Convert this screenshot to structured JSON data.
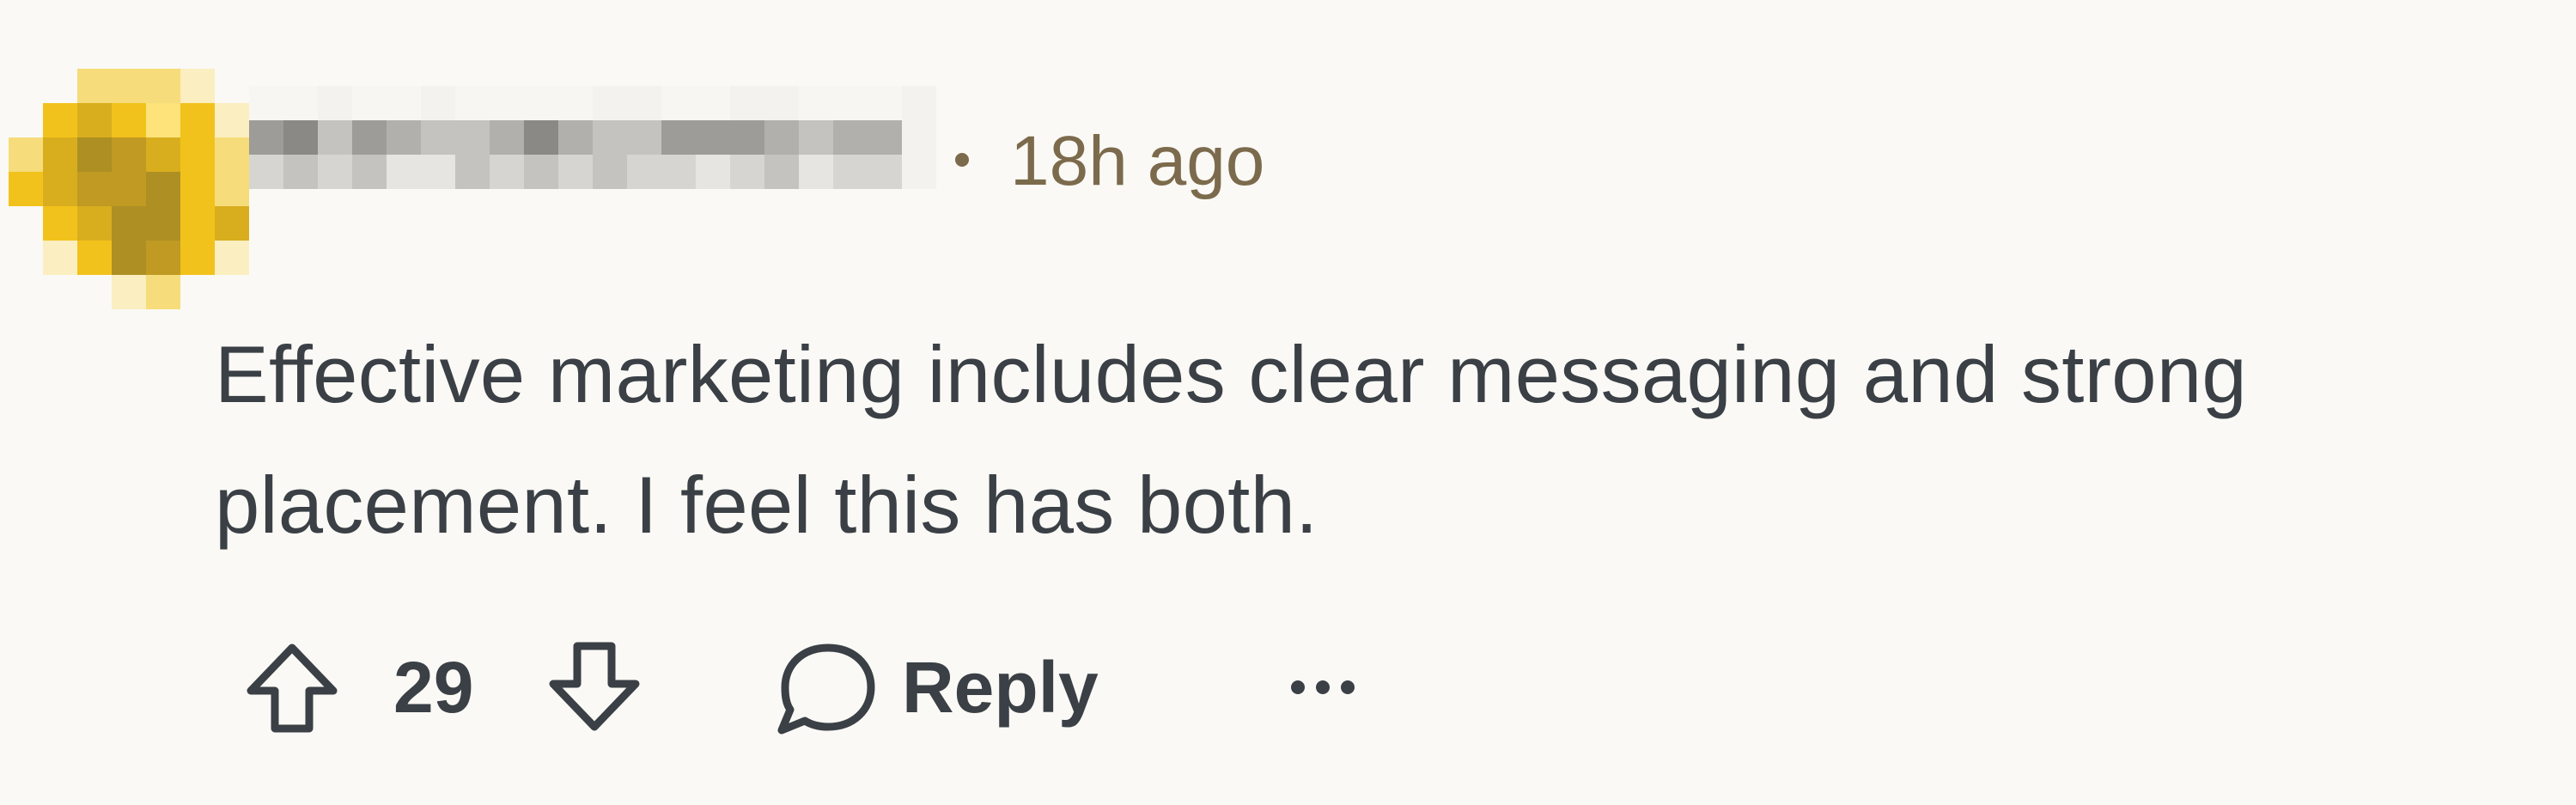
{
  "comment": {
    "author": {
      "avatar_icon": "pixelated-avatar",
      "avatar_color": "#f2c21c",
      "username_icon": "pixelated-username"
    },
    "separator": "•",
    "timestamp": "18h ago",
    "body": "Effective marketing includes clear messaging and strong placement. I feel this has both.",
    "actions": {
      "upvote_icon": "arrow-up-icon",
      "vote_count": "29",
      "downvote_icon": "arrow-down-icon",
      "reply_icon": "speech-bubble-icon",
      "reply_label": "Reply",
      "more_icon": "ellipsis-icon"
    },
    "colors": {
      "background": "#faf9f5",
      "text": "#3a4045",
      "meta": "#7c6a4c"
    }
  }
}
